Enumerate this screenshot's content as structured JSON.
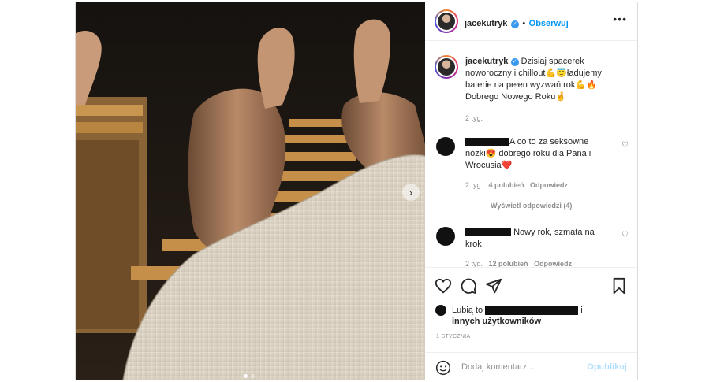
{
  "post": {
    "username": "jacekutryk",
    "follow_label": "Obserwuj",
    "more_label": "•••",
    "next_label": "›",
    "caption": {
      "username": "jacekutryk",
      "line1": "Dzisiaj spacerek",
      "line2": "noworoczny i chillout💪😇ładujemy",
      "line3": "baterie na pełen wyzwań rok💪🔥",
      "line4": "Dobrego Nowego Roku🤞",
      "time": "2 tyg."
    },
    "comments": [
      {
        "text_line1": "A co to za seksowne",
        "text_line2": "nóżki😍 dobrego roku dla Pana i",
        "text_line3": "Wrocusia❤️",
        "time": "2 tyg.",
        "likes": "4 polubień",
        "reply_label": "Odpowiedz",
        "view_replies": "Wyświetl odpowiedzi (4)"
      },
      {
        "text_line1": "Nowy rok, szmata na",
        "text_line2": "krok",
        "time": "2 tyg.",
        "likes": "12 polubień",
        "reply_label": "Odpowiedz"
      }
    ],
    "likes_prefix": "Lubią to",
    "likes_and": "i",
    "likes_others": "innych użytkowników",
    "date": "1 STYCZNIA",
    "comment_placeholder": "Dodaj komentarz...",
    "publish_label": "Opublikuj"
  },
  "colors": {
    "accent": "#0095f6",
    "publish_disabled": "#b2dffc",
    "muted": "#8e8e8e"
  },
  "icons": [
    "verified-badge-icon",
    "more-options-icon",
    "next-arrow-icon",
    "heart-icon",
    "comment-icon",
    "share-icon",
    "bookmark-icon",
    "emoji-icon"
  ]
}
